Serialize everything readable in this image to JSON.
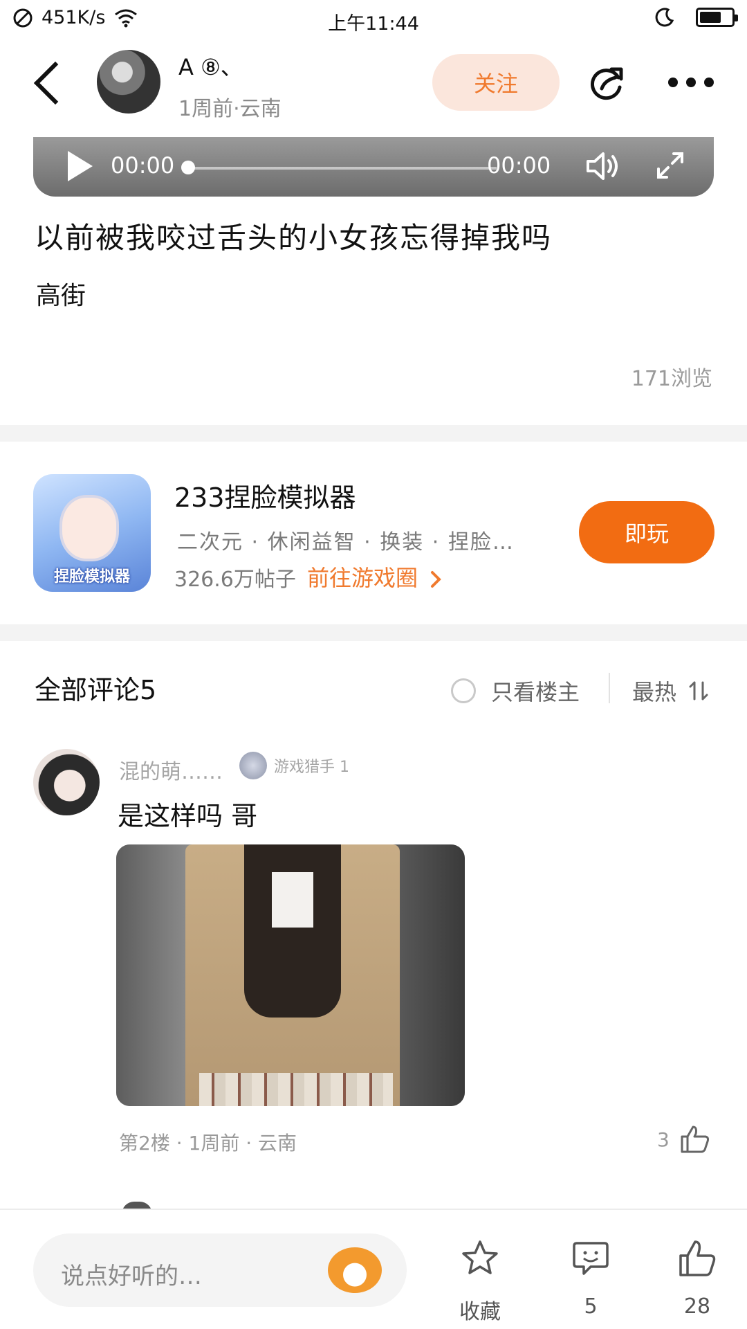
{
  "status_bar": {
    "net_speed": "451K/s",
    "time": "上午11:44"
  },
  "header": {
    "author_name": "A ⑧、",
    "meta": "1周前·云南",
    "follow_label": "关注"
  },
  "video": {
    "current_time": "00:00",
    "duration": "00:00"
  },
  "post": {
    "title": "以前被我咬过舌头的小女孩忘得掉我吗",
    "tag": "高街",
    "views": "171浏览"
  },
  "game": {
    "name": "233捏脸模拟器",
    "icon_label": "捏脸模拟器",
    "tags": "二次元 · 休闲益智 · 换装 · 捏脸…",
    "posts": "326.6万帖子",
    "link": "前往游戏圈",
    "play_label": "即玩"
  },
  "comments": {
    "title": "全部评论5",
    "only_host": "只看楼主",
    "sort": "最热",
    "items": [
      {
        "user": "混的萌……",
        "badge": "游戏猎手 1",
        "text": "是这样吗 哥",
        "meta": "第2楼 · 1周前 · 云南",
        "likes": "3"
      }
    ]
  },
  "bottom_bar": {
    "placeholder": "说点好听的…",
    "collect_label": "收藏",
    "comment_count": "5",
    "like_count": "28"
  }
}
